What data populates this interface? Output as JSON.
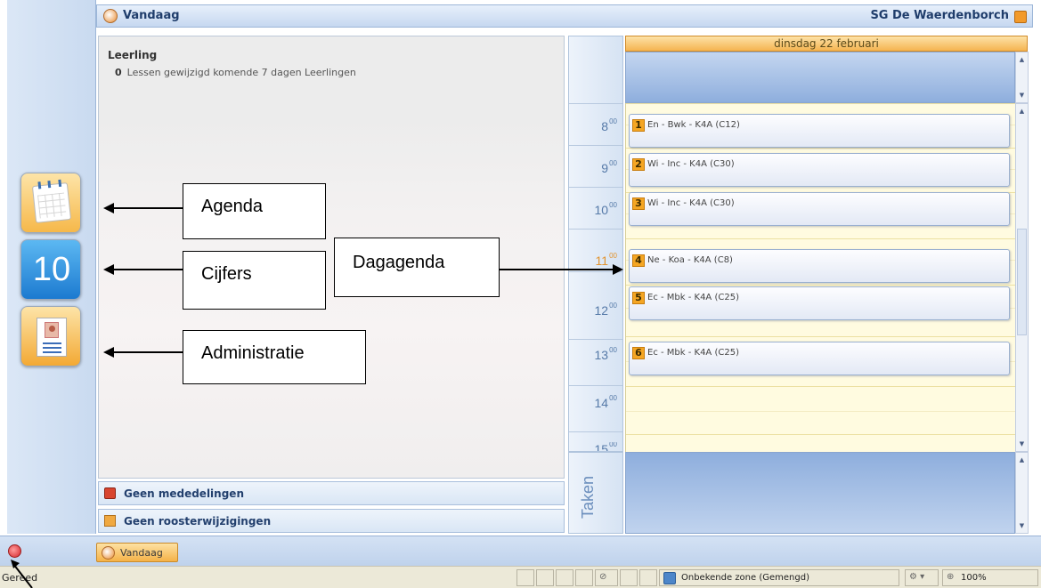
{
  "header": {
    "title": "Vandaag",
    "school": "SG De Waerdenborch"
  },
  "left_nav": {
    "items": [
      {
        "name": "Agenda",
        "icon": "calendar-icon"
      },
      {
        "name": "Cijfers",
        "icon": "grade-ten-icon",
        "glyph": "10"
      },
      {
        "name": "Administratie",
        "icon": "id-card-icon"
      }
    ]
  },
  "info": {
    "heading": "Leerling",
    "count": "0",
    "line": "Lessen gewijzigd komende 7 dagen Leerlingen"
  },
  "bottom_rows": {
    "messages": "Geen mededelingen",
    "rooster": "Geen roosterwijzigingen"
  },
  "day_view": {
    "date": "dinsdag 22 februari",
    "hours": [
      {
        "hour": "8",
        "min": "00"
      },
      {
        "hour": "9",
        "min": "00"
      },
      {
        "hour": "10",
        "min": "00"
      },
      {
        "hour": "11",
        "min": "00"
      },
      {
        "hour": "12",
        "min": "00"
      },
      {
        "hour": "13",
        "min": "00"
      },
      {
        "hour": "14",
        "min": "00"
      },
      {
        "hour": "15",
        "min": "00"
      }
    ],
    "taken_label": "Taken",
    "appointments": [
      {
        "num": "1",
        "text": "En - Bwk - K4A  (C12)"
      },
      {
        "num": "2",
        "text": "Wi - Inc - K4A  (C30)"
      },
      {
        "num": "3",
        "text": "Wi - Inc - K4A  (C30)"
      },
      {
        "num": "4",
        "text": "Ne - Koa - K4A  (C8)"
      },
      {
        "num": "5",
        "text": "Ec - Mbk - K4A  (C25)"
      },
      {
        "num": "6",
        "text": "Ec - Mbk - K4A  (C25)"
      }
    ]
  },
  "taskbar": {
    "tab_label": "Vandaag"
  },
  "statusbar": {
    "status": "Gereed",
    "zone": "Onbekende zone (Gemengd)",
    "zoom": "100%"
  },
  "annotations": {
    "agenda": "Agenda",
    "cijfers": "Cijfers",
    "administratie": "Administratie",
    "dagagenda": "Dagagenda"
  },
  "colors": {
    "header_text": "#1f3d6b",
    "appointment_badge": "#f5a623",
    "day_header": "#f5b450",
    "grid_background": "#fffbe0"
  }
}
